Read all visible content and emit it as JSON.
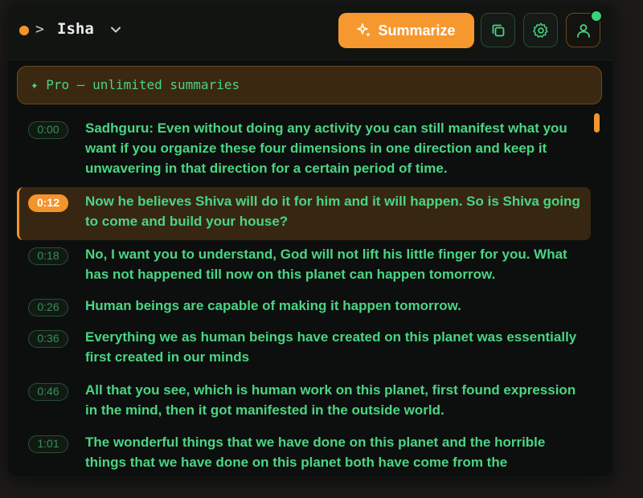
{
  "header": {
    "prompt_sign": ">",
    "channel_name": "Isha",
    "summarize_label": "Summarize",
    "status_color": "#f3942d",
    "accent_color": "#f7982f"
  },
  "pro_banner": {
    "text": "✦ Pro — unlimited summaries"
  },
  "transcript": [
    {
      "time": "0:00",
      "text": "Sadhguru: Even without doing any activity you can still manifest what you want if you organize these four dimensions in one direction and keep it unwavering in that direction for a certain period of time.",
      "active": false
    },
    {
      "time": "0:12",
      "text": "Now he believes Shiva will do it for him and it will happen. So is Shiva going to come and build your house?",
      "active": true
    },
    {
      "time": "0:18",
      "text": "No, I want you to understand, God will not lift his little finger for you. What has not happened till now on this planet can happen tomorrow.",
      "active": false
    },
    {
      "time": "0:26",
      "text": "Human beings are capable of making it happen tomorrow.",
      "active": false
    },
    {
      "time": "0:36",
      "text": "Everything we as human beings have created on this planet was essentially first created in our minds",
      "active": false
    },
    {
      "time": "0:46",
      "text": "All that you see, which is human work on this planet, first found expression in the mind, then it got manifested in the outside world.",
      "active": false
    },
    {
      "time": "1:01",
      "text": "The wonderful things that we have done on this planet and the horrible things that we have done on this planet both have come from the",
      "active": false
    }
  ]
}
